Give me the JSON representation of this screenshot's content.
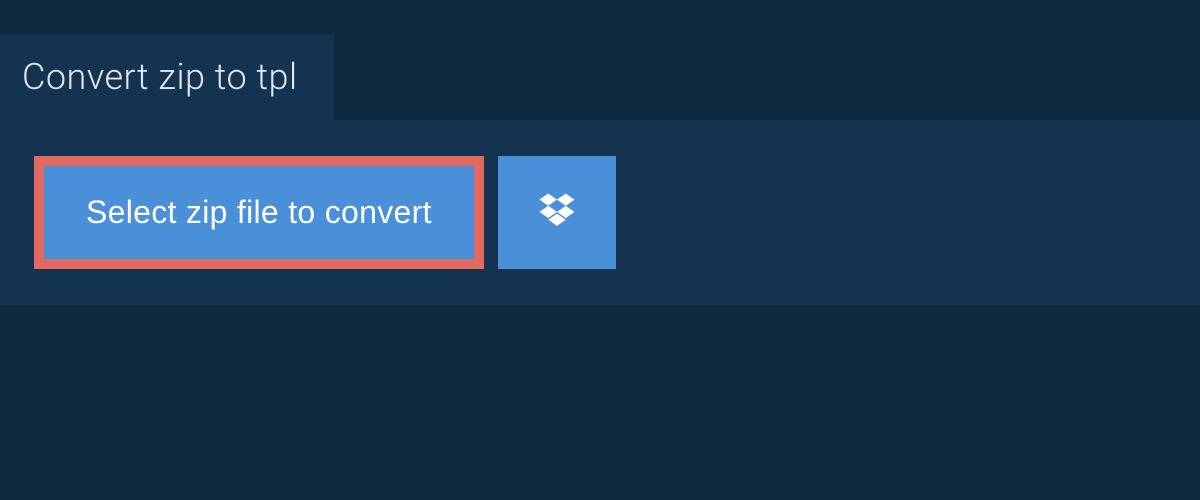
{
  "header": {
    "title": "Convert zip to tpl"
  },
  "actions": {
    "select_label": "Select zip file to convert"
  }
}
